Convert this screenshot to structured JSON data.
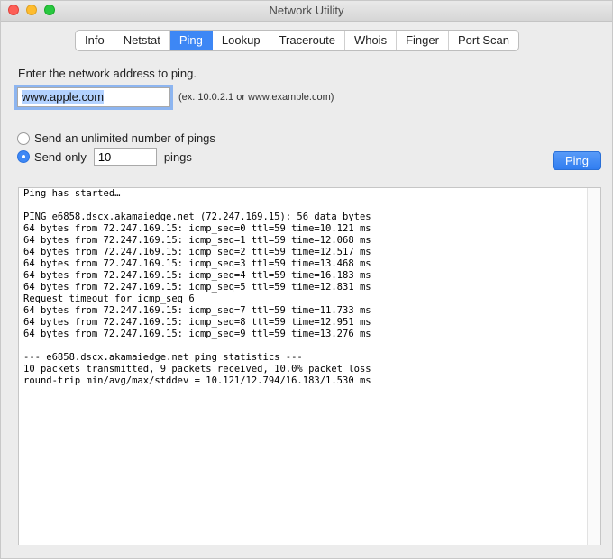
{
  "window": {
    "title": "Network Utility"
  },
  "tabs": [
    {
      "label": "Info"
    },
    {
      "label": "Netstat"
    },
    {
      "label": "Ping"
    },
    {
      "label": "Lookup"
    },
    {
      "label": "Traceroute"
    },
    {
      "label": "Whois"
    },
    {
      "label": "Finger"
    },
    {
      "label": "Port Scan"
    }
  ],
  "active_tab": "Ping",
  "form": {
    "prompt": "Enter the network address to ping.",
    "address_value": "www.apple.com",
    "address_hint": "(ex. 10.0.2.1 or www.example.com)",
    "option_unlimited": "Send an unlimited number of pings",
    "option_send_only": "Send only",
    "ping_count": "10",
    "pings_suffix": "pings",
    "selected_option": "send_only",
    "ping_button": "Ping"
  },
  "output": {
    "lines": [
      "Ping has started…",
      "",
      "PING e6858.dscx.akamaiedge.net (72.247.169.15): 56 data bytes",
      "64 bytes from 72.247.169.15: icmp_seq=0 ttl=59 time=10.121 ms",
      "64 bytes from 72.247.169.15: icmp_seq=1 ttl=59 time=12.068 ms",
      "64 bytes from 72.247.169.15: icmp_seq=2 ttl=59 time=12.517 ms",
      "64 bytes from 72.247.169.15: icmp_seq=3 ttl=59 time=13.468 ms",
      "64 bytes from 72.247.169.15: icmp_seq=4 ttl=59 time=16.183 ms",
      "64 bytes from 72.247.169.15: icmp_seq=5 ttl=59 time=12.831 ms",
      "Request timeout for icmp_seq 6",
      "64 bytes from 72.247.169.15: icmp_seq=7 ttl=59 time=11.733 ms",
      "64 bytes from 72.247.169.15: icmp_seq=8 ttl=59 time=12.951 ms",
      "64 bytes from 72.247.169.15: icmp_seq=9 ttl=59 time=13.276 ms",
      "",
      "--- e6858.dscx.akamaiedge.net ping statistics ---",
      "10 packets transmitted, 9 packets received, 10.0% packet loss",
      "round-trip min/avg/max/stddev = 10.121/12.794/16.183/1.530 ms"
    ]
  },
  "colors": {
    "accent": "#3d87f5",
    "window_bg": "#ececec"
  }
}
